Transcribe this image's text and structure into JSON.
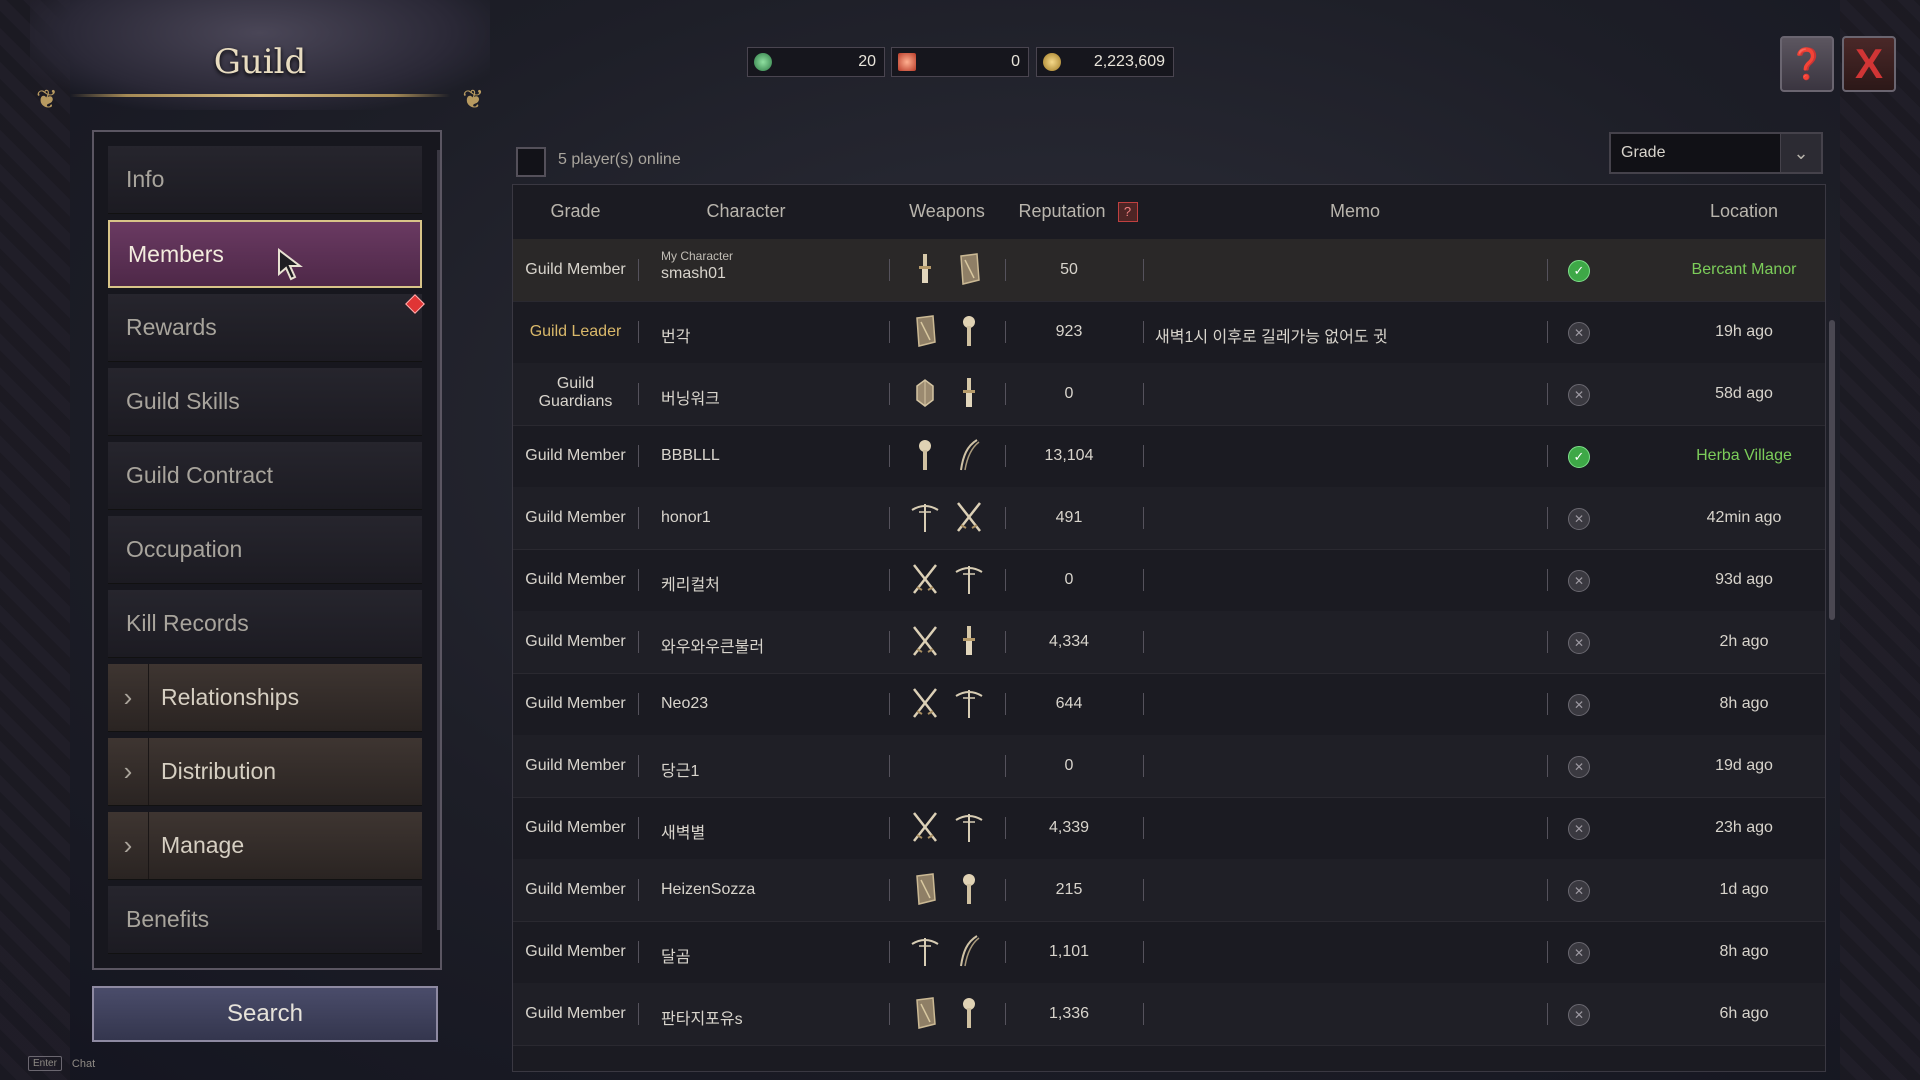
{
  "header": {
    "title": "Guild",
    "currencies": [
      {
        "name": "green-gem",
        "value": "20",
        "color": "#3da05a"
      },
      {
        "name": "red-flag",
        "value": "0",
        "color": "#d84a3a"
      },
      {
        "name": "gold-coin",
        "value": "2,223,609",
        "color": "#c79a36"
      }
    ],
    "help_icon": "help-book-icon",
    "close_icon": "close-icon",
    "close_label": "X"
  },
  "menu": {
    "items": [
      {
        "label": "Info"
      },
      {
        "label": "Members",
        "active": true
      },
      {
        "label": "Rewards"
      },
      {
        "label": "Guild Skills"
      },
      {
        "label": "Guild Contract"
      },
      {
        "label": "Occupation"
      },
      {
        "label": "Kill Records"
      },
      {
        "label": "Relationships",
        "expandable": true
      },
      {
        "label": "Distribution",
        "expandable": true
      },
      {
        "label": "Manage",
        "expandable": true
      },
      {
        "label": "Benefits"
      }
    ],
    "search_label": "Search",
    "enter_key": "Enter",
    "chat_label": "Chat"
  },
  "main": {
    "online_text": "5 player(s) online",
    "grade_filter": "Grade",
    "columns": {
      "grade": "Grade",
      "character": "Character",
      "weapons": "Weapons",
      "reputation": "Reputation",
      "reputation_help": "?",
      "memo": "Memo",
      "location": "Location"
    },
    "rows": [
      {
        "grade": "Guild Member",
        "sub": "My Character",
        "name": "smash01",
        "weapons": [
          "dagger-icon",
          "shield-icon"
        ],
        "reputation": "50",
        "memo": "",
        "online": true,
        "location": "Bercant Manor"
      },
      {
        "grade": "Guild Leader",
        "name": "번각",
        "weapons": [
          "shield-icon",
          "mace-icon"
        ],
        "reputation": "923",
        "memo": "새벽1시 이후로 길레가능 없어도 귓",
        "online": false,
        "location": "19h ago"
      },
      {
        "grade": "Guild\nGuardians",
        "name": "버닝워크",
        "weapons": [
          "orb-icon",
          "dagger-icon"
        ],
        "reputation": "0",
        "memo": "",
        "online": false,
        "location": "58d ago"
      },
      {
        "grade": "Guild Member",
        "name": "BBBLLL",
        "weapons": [
          "mace-icon",
          "staff-icon"
        ],
        "reputation": "13,104",
        "memo": "",
        "online": true,
        "location": "Herba Village"
      },
      {
        "grade": "Guild Member",
        "name": "honor1",
        "weapons": [
          "crossbow-icon",
          "dual-swords-icon"
        ],
        "reputation": "491",
        "memo": "",
        "online": false,
        "location": "42min ago"
      },
      {
        "grade": "Guild Member",
        "name": "케리컬처",
        "weapons": [
          "dual-swords-icon",
          "crossbow-icon"
        ],
        "reputation": "0",
        "memo": "",
        "online": false,
        "location": "93d ago"
      },
      {
        "grade": "Guild Member",
        "name": "와우와우큰불러",
        "weapons": [
          "dual-swords-icon",
          "dagger-icon"
        ],
        "reputation": "4,334",
        "memo": "",
        "online": false,
        "location": "2h ago"
      },
      {
        "grade": "Guild Member",
        "name": "Neo23",
        "weapons": [
          "dual-swords-icon",
          "crossbow-icon"
        ],
        "reputation": "644",
        "memo": "",
        "online": false,
        "location": "8h ago"
      },
      {
        "grade": "Guild Member",
        "name": "당근1",
        "weapons": [],
        "reputation": "0",
        "memo": "",
        "online": false,
        "location": "19d ago"
      },
      {
        "grade": "Guild Member",
        "name": "새벽별",
        "weapons": [
          "dual-swords-icon",
          "crossbow-icon"
        ],
        "reputation": "4,339",
        "memo": "",
        "online": false,
        "location": "23h ago"
      },
      {
        "grade": "Guild Member",
        "name": "HeizenSozza",
        "weapons": [
          "shield-icon",
          "mace-icon"
        ],
        "reputation": "215",
        "memo": "",
        "online": false,
        "location": "1d ago"
      },
      {
        "grade": "Guild Member",
        "name": "달곰",
        "weapons": [
          "crossbow-icon",
          "staff-icon"
        ],
        "reputation": "1,101",
        "memo": "",
        "online": false,
        "location": "8h ago"
      },
      {
        "grade": "Guild Member",
        "name": "판타지포유s",
        "weapons": [
          "shield-icon",
          "mace-icon"
        ],
        "reputation": "1,336",
        "memo": "",
        "online": false,
        "location": "6h ago"
      }
    ]
  }
}
